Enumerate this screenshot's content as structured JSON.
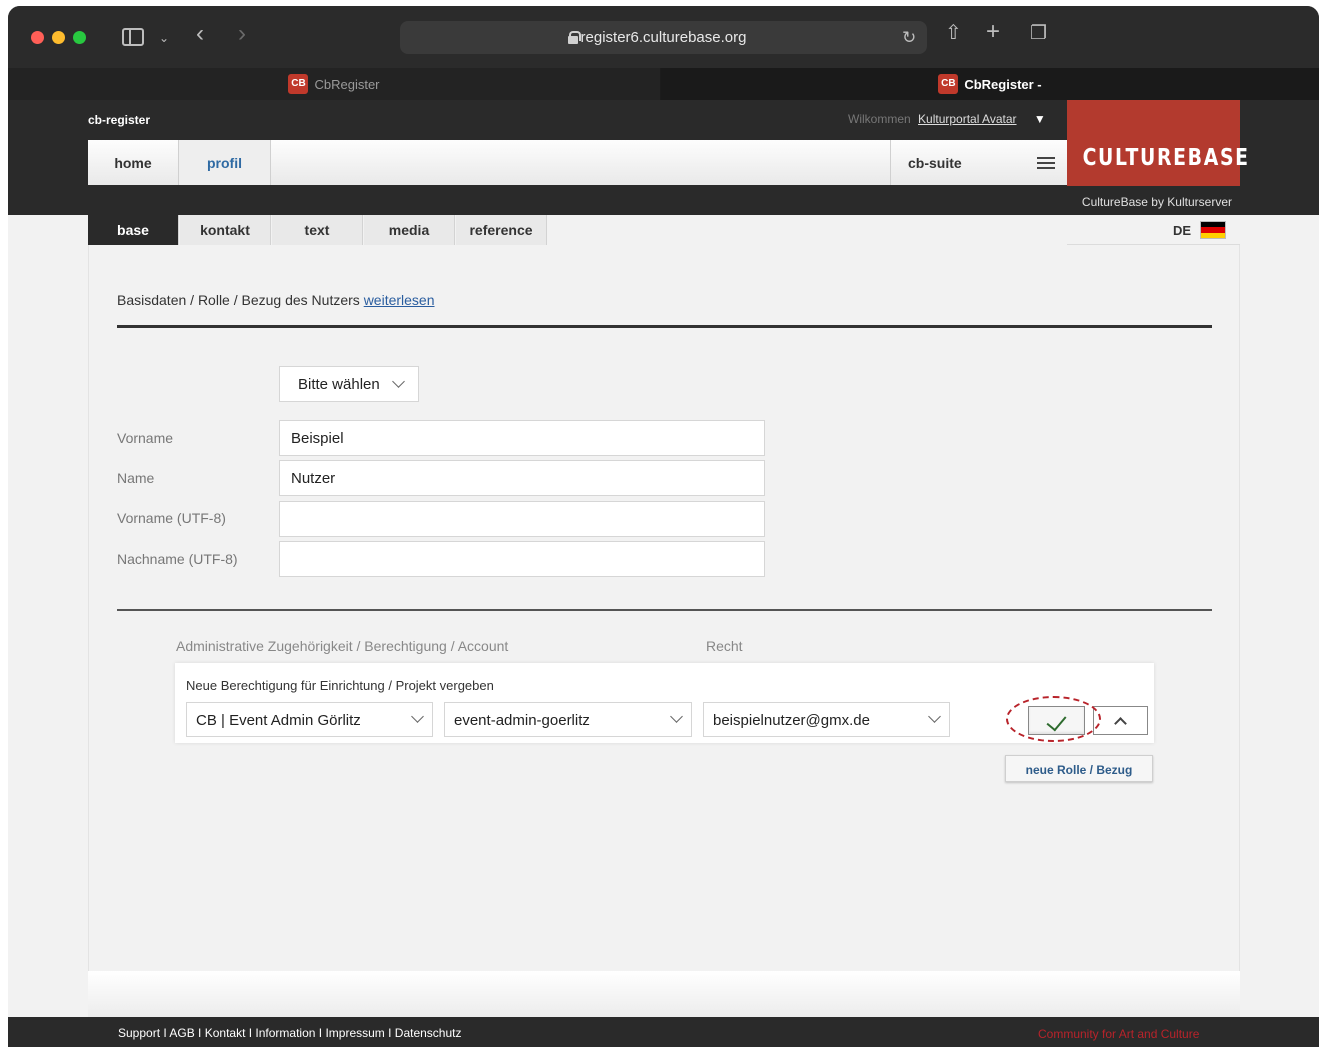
{
  "browser": {
    "url": "register6.culturebase.org",
    "tabs": [
      {
        "label": "CbRegister",
        "favicon": "CB"
      },
      {
        "label": "CbRegister -",
        "favicon": "CB"
      }
    ]
  },
  "header": {
    "brand": "cb-register",
    "welcome_label": "Wilkommen",
    "user_name": "Kulturportal Avatar",
    "logo_text": "CULTUREBASE",
    "logo_subtitle": "CultureBase by Kulturserver",
    "nav": {
      "home": "home",
      "profil": "profil",
      "suite": "cb-suite"
    }
  },
  "subtabs": [
    "base",
    "kontakt",
    "text",
    "media",
    "reference"
  ],
  "language": {
    "code": "DE",
    "flag_colors": [
      "#000000",
      "#dd0000",
      "#ffce00"
    ]
  },
  "intro": {
    "text": "Basisdaten / Rolle / Bezug des Nutzers ",
    "link": "weiterlesen"
  },
  "form": {
    "salutation": "Bitte wählen",
    "fields": [
      {
        "label": "Vorname",
        "value": "Beispiel"
      },
      {
        "label": "Name",
        "value": "Nutzer"
      },
      {
        "label": "Vorname (UTF-8)",
        "value": ""
      },
      {
        "label": "Nachname (UTF-8)",
        "value": ""
      }
    ]
  },
  "permissions": {
    "col_admin": "Administrative Zugehörigkeit / Berechtigung / Account",
    "col_recht": "Recht",
    "box_title": "Neue Berechtigung für Einrichtung / Projekt vergeben",
    "selects": [
      "CB | Event Admin Görlitz",
      "event-admin-goerlitz",
      "beispielnutzer@gmx.de"
    ],
    "new_role_button": "neue Rolle / Bezug"
  },
  "footer": {
    "links": "Support I AGB I Kontakt I Information I Impressum I Datenschutz",
    "slogan": "Community for Art and Culture"
  },
  "colors": {
    "brand_red": "#b33a2e",
    "link_blue": "#2a5d9f",
    "check_green": "#2e6b2e",
    "highlight_red": "#b8232a"
  }
}
